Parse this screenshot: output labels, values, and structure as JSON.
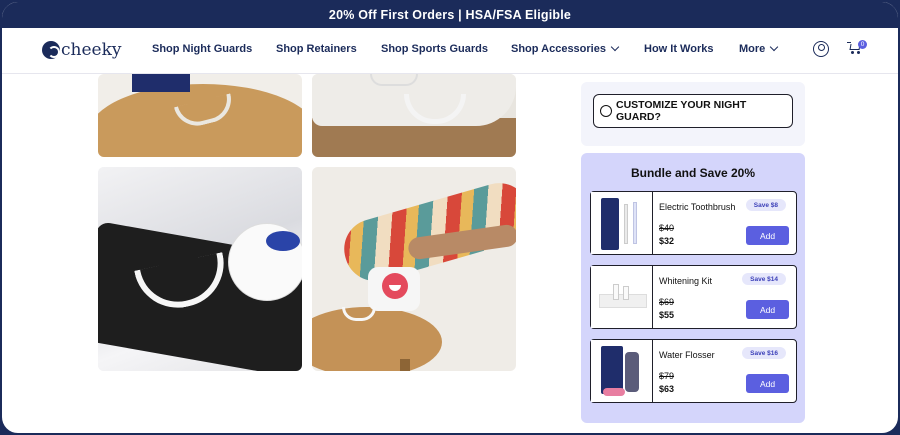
{
  "promo": {
    "text": "20% Off First Orders | HSA/FSA Eligible"
  },
  "header": {
    "logo_text": "cheeky",
    "nav": [
      {
        "label": "Shop Night Guards"
      },
      {
        "label": "Shop Retainers"
      },
      {
        "label": "Shop Sports Guards"
      },
      {
        "label": "Shop Accessories"
      },
      {
        "label": "How It Works"
      },
      {
        "label": "More"
      }
    ],
    "cart_count": "0",
    "icons": [
      "account-icon",
      "cart-icon",
      "chevron-down-icon"
    ]
  },
  "gallery": {
    "images": [
      {
        "subject": "night-guard-on-table"
      },
      {
        "subject": "night-guard-on-wood"
      },
      {
        "subject": "night-guard-with-case-on-tray"
      },
      {
        "subject": "hand-reaching-for-case"
      }
    ]
  },
  "customize": {
    "label": "CUSTOMIZE YOUR NIGHT GUARD?"
  },
  "bundle": {
    "title": "Bundle and Save 20%",
    "items": [
      {
        "name": "Electric Toothbrush",
        "save": "Save $8",
        "old_price": "$40",
        "price": "$32",
        "add_label": "Add"
      },
      {
        "name": "Whitening Kit",
        "save": "Save $14",
        "old_price": "$69",
        "price": "$55",
        "add_label": "Add"
      },
      {
        "name": "Water Flosser",
        "save": "Save $16",
        "old_price": "$79",
        "price": "$63",
        "add_label": "Add"
      }
    ]
  },
  "colors": {
    "navy": "#1b2b5a",
    "accent": "#5b5fe0",
    "bundle_bg": "#d4d5fb",
    "customize_bg": "#f3f4fb"
  }
}
